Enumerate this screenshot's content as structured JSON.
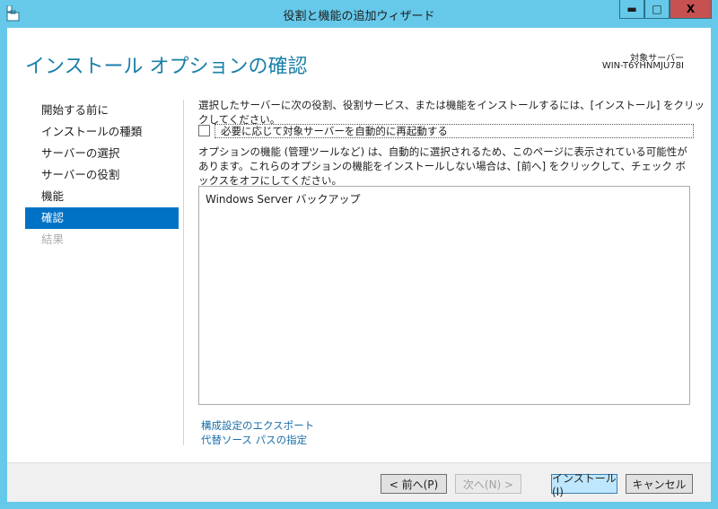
{
  "window": {
    "title": "役割と機能の追加ウィザード",
    "minimize": "▬",
    "maximize": "□",
    "close": "X"
  },
  "header": {
    "title": "インストール オプションの確認",
    "target_label": "対象サーバー",
    "target_value": "WIN-T6YHNMJU78I"
  },
  "nav": {
    "items": [
      {
        "label": "開始する前に",
        "state": "normal"
      },
      {
        "label": "インストールの種類",
        "state": "normal"
      },
      {
        "label": "サーバーの選択",
        "state": "normal"
      },
      {
        "label": "サーバーの役割",
        "state": "normal"
      },
      {
        "label": "機能",
        "state": "normal"
      },
      {
        "label": "確認",
        "state": "selected"
      },
      {
        "label": "結果",
        "state": "disabled"
      }
    ]
  },
  "main": {
    "intro": "選択したサーバーに次の役割、役割サービス、または機能をインストールするには、[インストール] をクリックしてください。",
    "restart_checkbox": {
      "label": "必要に応じて対象サーバーを自動的に再起動する",
      "checked": false
    },
    "note": "オプションの機能 (管理ツールなど) は、自動的に選択されるため、このページに表示されている可能性があります。これらのオプションの機能をインストールしない場合は、[前へ] をクリックして、チェック ボックスをオフにしてください。",
    "items": [
      "Windows Server バックアップ"
    ],
    "links": [
      "構成設定のエクスポート",
      "代替ソース パスの指定"
    ]
  },
  "footer": {
    "back": "< 前へ(P)",
    "next": "次へ(N) >",
    "install": "インストール(I)",
    "cancel": "キャンセル"
  },
  "colors": {
    "frame": "#66c9ea",
    "accent": "#0072c6",
    "heading": "#1a7fa8",
    "close": "#c75050"
  }
}
